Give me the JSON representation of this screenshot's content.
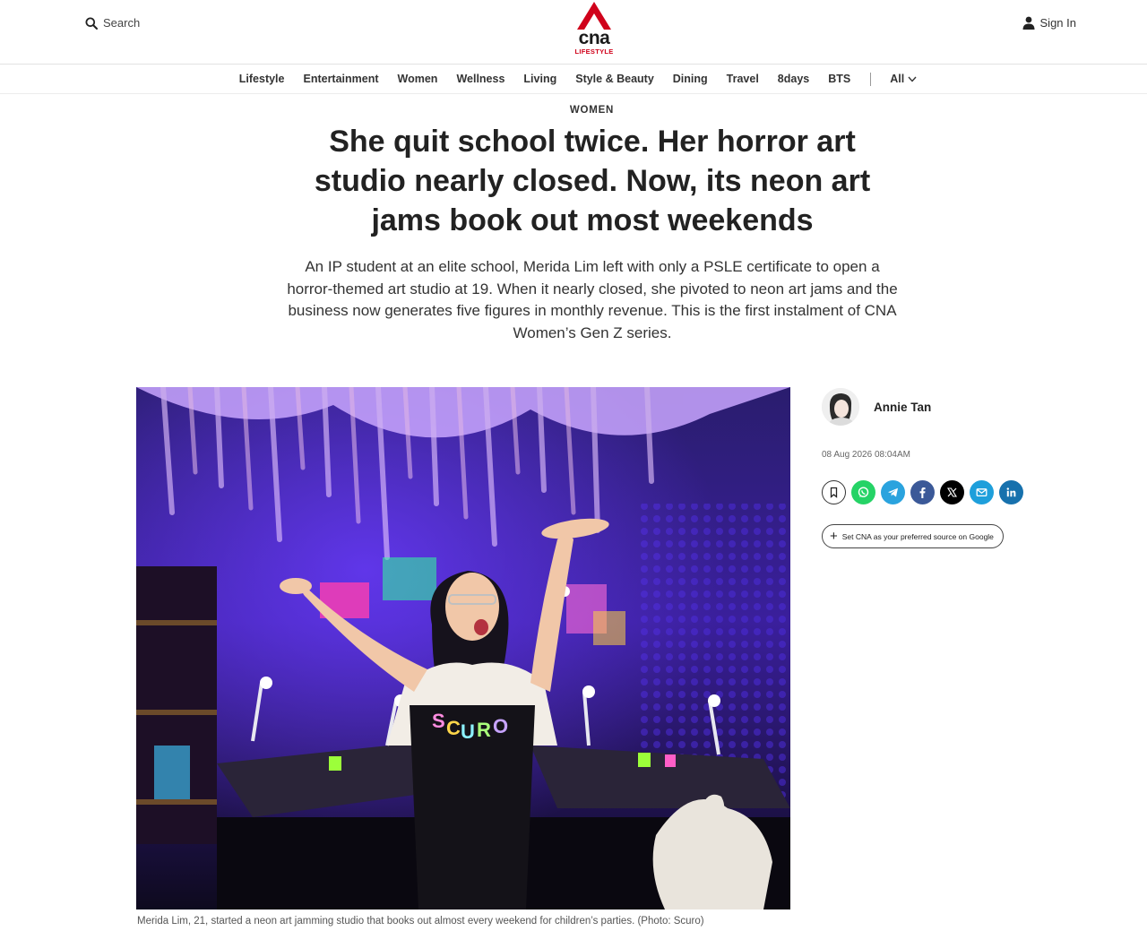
{
  "header": {
    "search_label": "Search",
    "logo_text": "cna",
    "logo_sub": "LIFESTYLE",
    "signin_label": "Sign In"
  },
  "nav": {
    "items": [
      "Lifestyle",
      "Entertainment",
      "Women",
      "Wellness",
      "Living",
      "Style & Beauty",
      "Dining",
      "Travel",
      "8days",
      "BTS"
    ],
    "all_label": "All"
  },
  "article": {
    "category": "WOMEN",
    "headline": "She quit school twice. Her horror art studio nearly closed. Now, its neon art jams book out most weekends",
    "deck": "An IP student at an elite school, Merida Lim left with only a PSLE certificate to open a horror-themed art studio at 19. When it nearly closed, she pivoted to neon art jams and the business now generates five figures in monthly revenue. This is the first instalment of CNA Women’s Gen Z series.",
    "caption": "Merida Lim, 21, started a neon art jamming studio that books out almost every weekend for children’s parties. (Photo: Scuro)"
  },
  "sidebar": {
    "author_name": "Annie Tan",
    "date": "08 Aug 2026 08:04AM",
    "share_icons": [
      "bookmark-icon",
      "whatsapp-icon",
      "telegram-icon",
      "facebook-icon",
      "x-icon",
      "email-icon",
      "linkedin-icon"
    ],
    "preferred_source_label": "Set CNA as your preferred source on Google"
  },
  "colors": {
    "brand_red": "#d0021b",
    "whatsapp": "#25d366",
    "telegram": "#2aa3de",
    "facebook": "#3b5998",
    "x": "#000000",
    "email": "#1e9fdb",
    "linkedin": "#1771ad"
  }
}
